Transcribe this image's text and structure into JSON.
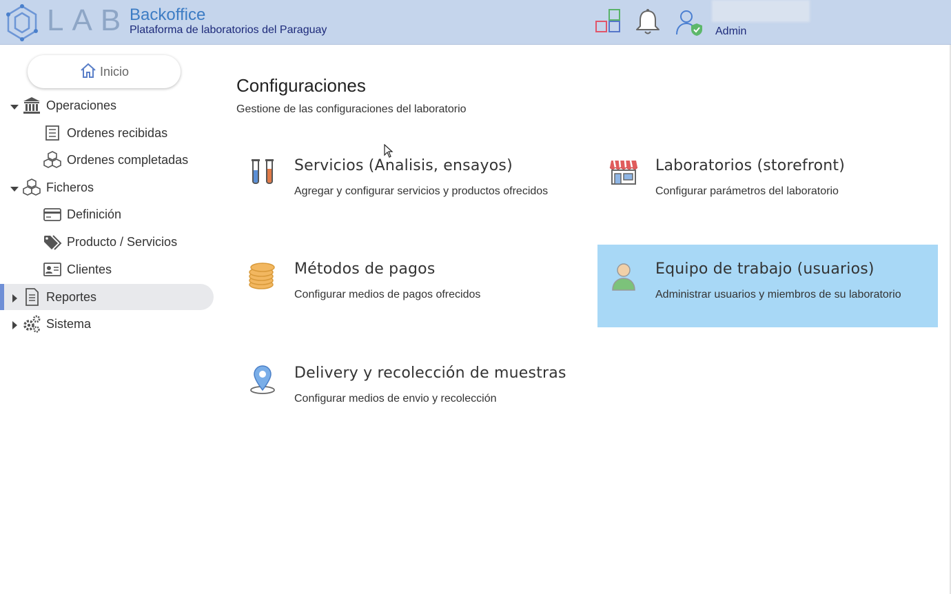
{
  "header": {
    "logo_text": "LAB",
    "title": "Backoffice",
    "subtitle": "Plataforma de laboratorios del Paraguay",
    "icons": [
      "apps-grid-icon",
      "bell-icon",
      "user-shield-icon"
    ],
    "user": {
      "role": "Admin"
    }
  },
  "sidebar": {
    "home_label": "Inicio",
    "items": [
      {
        "label": "Operaciones",
        "icon": "bank-icon",
        "expanded": true
      },
      {
        "label": "Ordenes recibidas",
        "icon": "checklist-icon"
      },
      {
        "label": "Ordenes completadas",
        "icon": "boxes-icon"
      },
      {
        "label": "Ficheros",
        "icon": "boxes-icon",
        "expanded": true
      },
      {
        "label": "Definición",
        "icon": "card-icon"
      },
      {
        "label": "Producto / Servicios",
        "icon": "tags-icon"
      },
      {
        "label": "Clientes",
        "icon": "id-card-icon"
      },
      {
        "label": "Reportes",
        "icon": "document-icon",
        "expanded": false,
        "active": true
      },
      {
        "label": "Sistema",
        "icon": "gears-icon",
        "expanded": false
      }
    ]
  },
  "main": {
    "title": "Configuraciones",
    "subtitle": "Gestione de las configuraciones del laboratorio",
    "cards": [
      {
        "title": "Servicios (Analisis, ensayos)",
        "desc": "Agregar y configurar servicios y productos ofrecidos",
        "icon": "test-tubes-icon"
      },
      {
        "title": "Laboratorios (storefront)",
        "desc": "Configurar parámetros del laboratorio",
        "icon": "storefront-icon"
      },
      {
        "title": "Métodos de pagos",
        "desc": "Configurar medios de pagos ofrecidos",
        "icon": "coins-icon"
      },
      {
        "title": "Equipo de trabajo (usuarios)",
        "desc": "Administrar usuarios y miembros de su laboratorio",
        "icon": "user-icon",
        "highlighted": true
      },
      {
        "title": "Delivery y recolección de muestras",
        "desc": "Configurar medios de envio y recolección",
        "icon": "location-pin-icon"
      }
    ]
  },
  "colors": {
    "header_bg": "#c5d5ec",
    "brand_blue": "#3c7cc4",
    "navy": "#1d2a7a",
    "highlight_card": "#a8d8f6",
    "active_nav": "#e8e9ec"
  }
}
